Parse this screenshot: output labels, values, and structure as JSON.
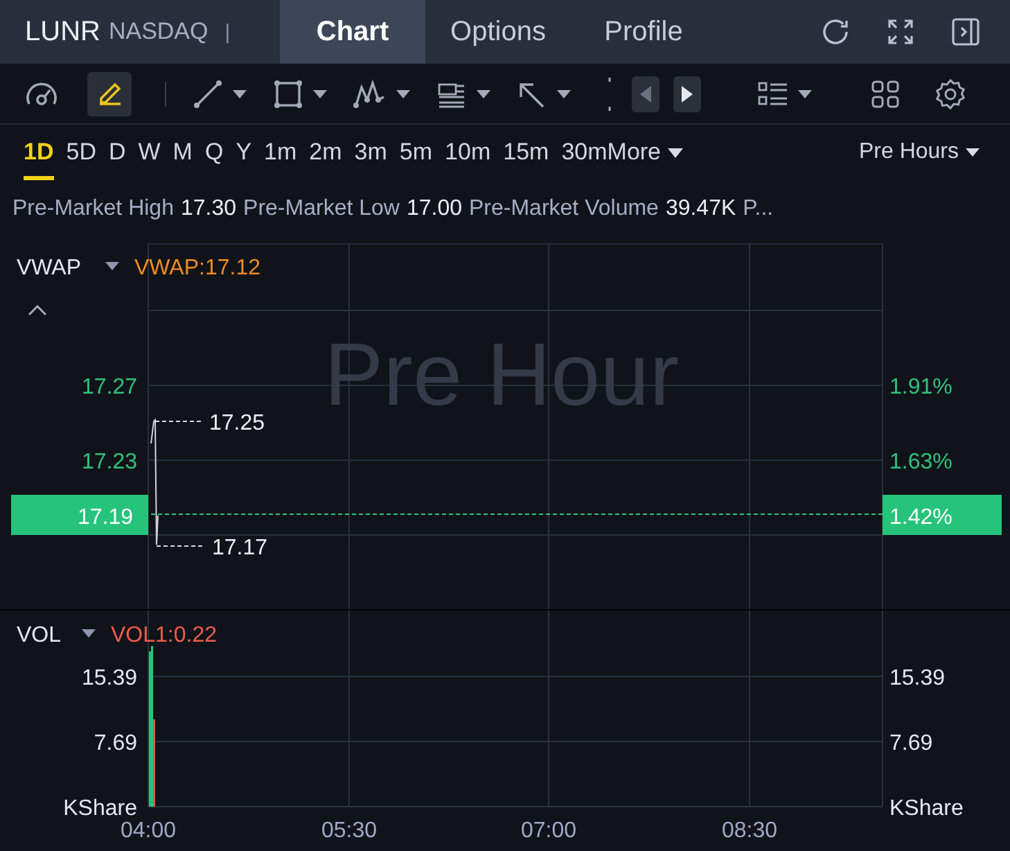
{
  "header": {
    "symbol": "LUNR",
    "exchange": "NASDAQ",
    "separator": "|",
    "tabs": [
      {
        "label": "Chart",
        "selected": true
      },
      {
        "label": "Options",
        "selected": false
      },
      {
        "label": "Profile",
        "selected": false
      }
    ]
  },
  "toolbar": {
    "draw_tool_active": true
  },
  "intervals": [
    {
      "label": "1D",
      "selected": true
    },
    {
      "label": "5D",
      "selected": false
    },
    {
      "label": "D",
      "selected": false
    },
    {
      "label": "W",
      "selected": false
    },
    {
      "label": "M",
      "selected": false
    },
    {
      "label": "Q",
      "selected": false
    },
    {
      "label": "Y",
      "selected": false
    },
    {
      "label": "1m",
      "selected": false
    },
    {
      "label": "2m",
      "selected": false
    },
    {
      "label": "3m",
      "selected": false
    },
    {
      "label": "5m",
      "selected": false
    },
    {
      "label": "10m",
      "selected": false
    },
    {
      "label": "15m",
      "selected": false
    },
    {
      "label": "30m",
      "selected": false
    }
  ],
  "more": "More",
  "session": "Pre Hours",
  "stats": [
    {
      "label": "Pre-Market High",
      "value": "17.30"
    },
    {
      "label": "Pre-Market Low",
      "value": "17.00"
    },
    {
      "label": "Pre-Market Volume",
      "value": "39.47K"
    },
    {
      "label": "P..."
    }
  ],
  "price_panel": {
    "indicator": "VWAP",
    "reading": "VWAP:17.12",
    "watermark": "Pre Hour",
    "left_ticks": [
      "17.27",
      "17.23"
    ],
    "right_ticks": [
      "1.91%",
      "1.63%"
    ],
    "high": "17.25",
    "low": "17.17",
    "current_price": "17.19",
    "current_change": "1.42%"
  },
  "volume_panel": {
    "indicator": "VOL",
    "reading": "VOL1:0.22",
    "left_ticks": [
      "15.39",
      "7.69",
      "KShare"
    ],
    "right_ticks": [
      "15.39",
      "7.69",
      "KShare"
    ]
  },
  "x_axis": [
    "04:00",
    "05:30",
    "07:00",
    "08:30"
  ]
}
